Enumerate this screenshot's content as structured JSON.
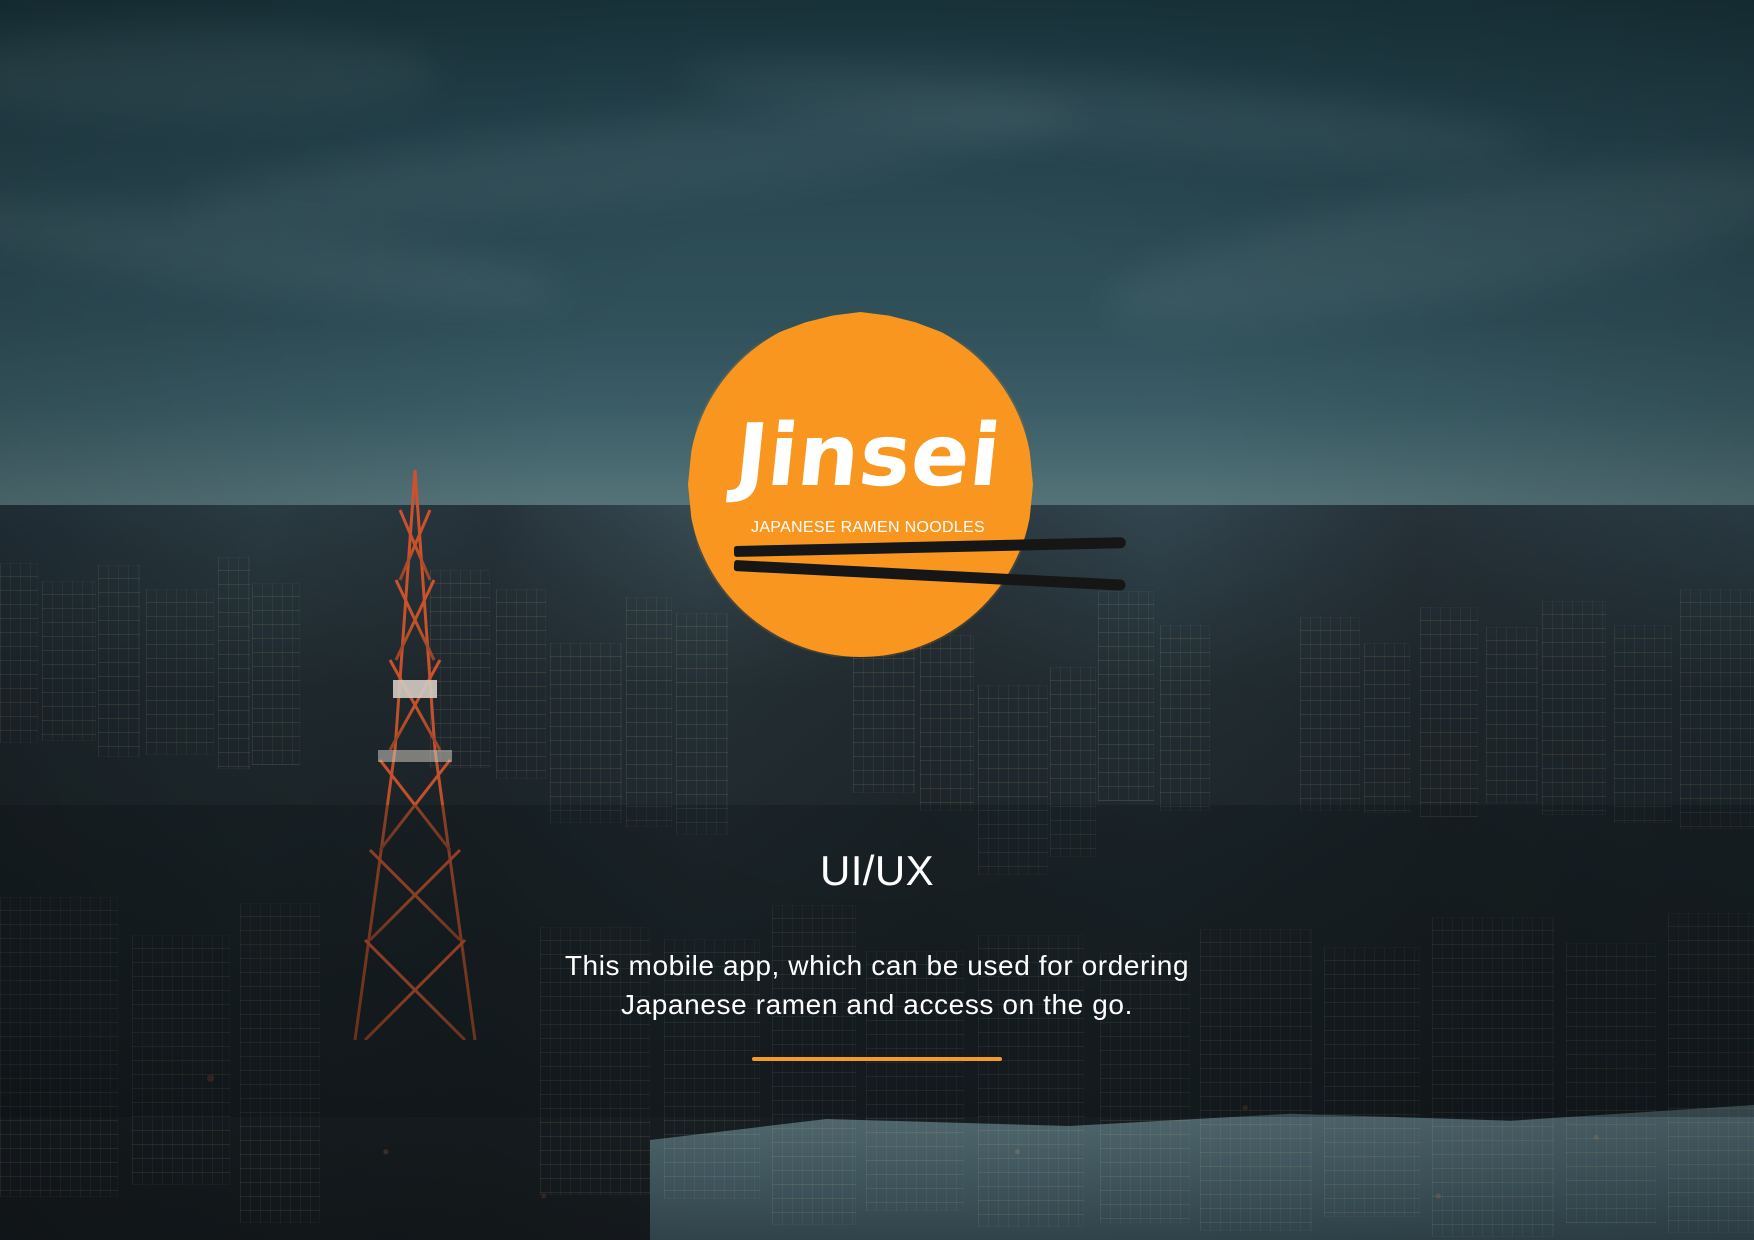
{
  "brand": {
    "name": "Jinsei",
    "subtitle": "JAPANESE RAMEN NOODLES"
  },
  "content": {
    "title": "UI/UX",
    "description": "This mobile app, which can be used for ordering\nJapanese ramen and access on the go."
  },
  "colors": {
    "accent": "#F8961F",
    "chopsticks": "#161616",
    "text": "#FFFFFF"
  },
  "icons": {
    "brand_mark": "chopsticks-icon"
  }
}
